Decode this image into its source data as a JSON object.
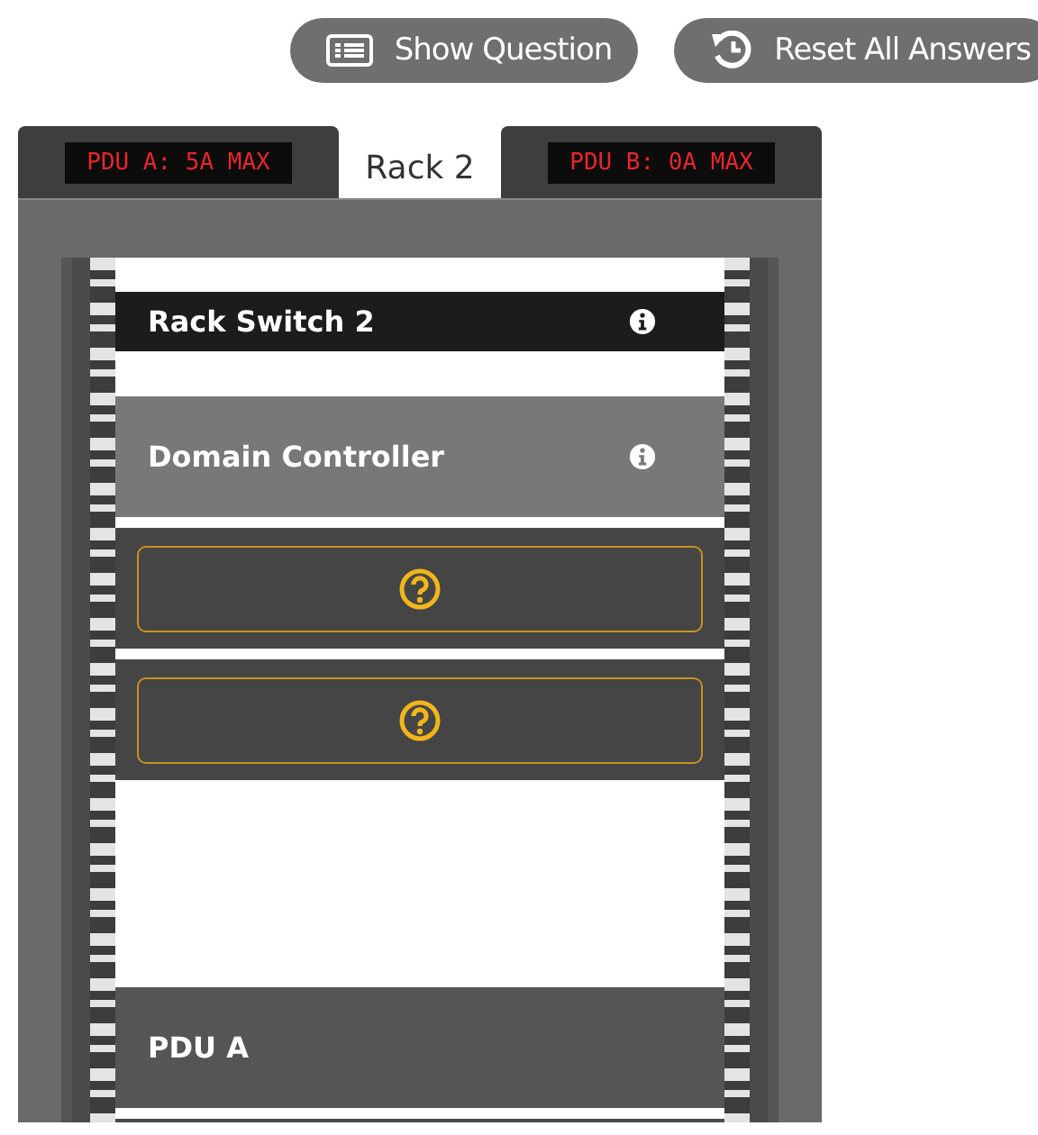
{
  "toolbar": {
    "buttons": [
      {
        "kind": "question",
        "label": "Show Question"
      },
      {
        "kind": "reset",
        "label": "Reset All Answers"
      }
    ]
  },
  "tabs": [
    {
      "kind": "meter",
      "label": "PDU A: 5A MAX",
      "selected": false
    },
    {
      "kind": "tab",
      "label": "Rack 2",
      "selected": true
    },
    {
      "kind": "meter",
      "label": "PDU B: 0A MAX",
      "selected": false
    }
  ],
  "slots": [
    {
      "kind": "spacer"
    },
    {
      "kind": "switch",
      "name": "Rack Switch 2",
      "color": "#1c1c1c",
      "info": true
    },
    {
      "kind": "gap"
    },
    {
      "kind": "server",
      "name": "Domain Controller",
      "color": "#787878",
      "info": true
    },
    {
      "kind": "divider"
    },
    {
      "kind": "answer"
    },
    {
      "kind": "divider"
    },
    {
      "kind": "answer"
    },
    {
      "kind": "void"
    },
    {
      "kind": "server",
      "name": "PDU A",
      "color": "#555555",
      "info": false
    },
    {
      "kind": "divider"
    }
  ]
}
